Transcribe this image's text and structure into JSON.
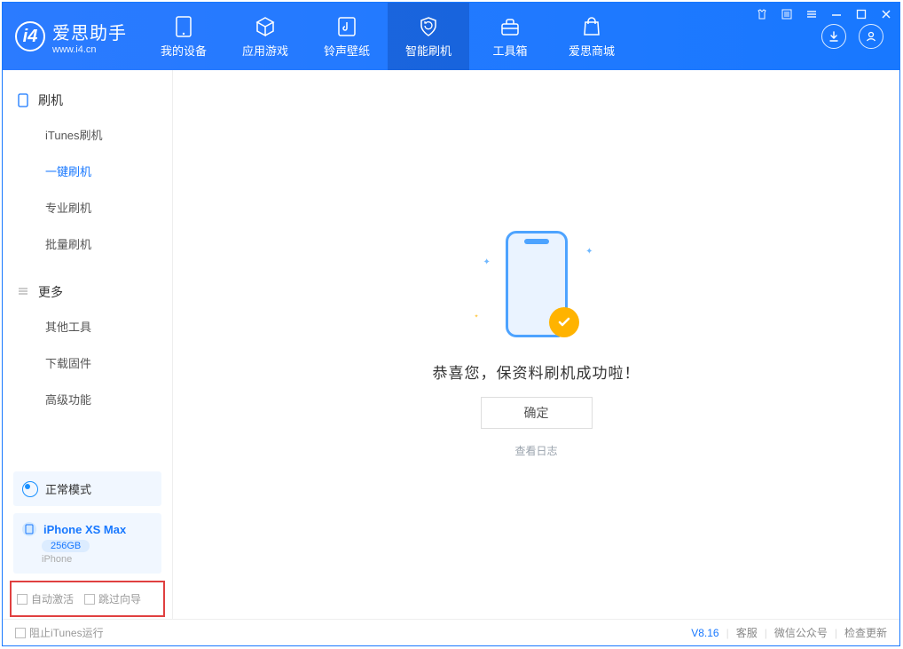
{
  "brand": {
    "cn": "爱思助手",
    "en": "www.i4.cn"
  },
  "nav": {
    "items": [
      {
        "label": "我的设备"
      },
      {
        "label": "应用游戏"
      },
      {
        "label": "铃声壁纸"
      },
      {
        "label": "智能刷机"
      },
      {
        "label": "工具箱"
      },
      {
        "label": "爱思商城"
      }
    ],
    "active_index": 3
  },
  "sidebar": {
    "section1_title": "刷机",
    "section1_items": [
      "iTunes刷机",
      "一键刷机",
      "专业刷机",
      "批量刷机"
    ],
    "section1_active": 1,
    "section2_title": "更多",
    "section2_items": [
      "其他工具",
      "下载固件",
      "高级功能"
    ]
  },
  "mode": {
    "label": "正常模式"
  },
  "device": {
    "name": "iPhone XS Max",
    "capacity": "256GB",
    "type": "iPhone"
  },
  "checks": {
    "auto_activate": "自动激活",
    "skip_wizard": "跳过向导"
  },
  "main": {
    "success_text": "恭喜您，保资料刷机成功啦！",
    "ok_button": "确定",
    "view_log": "查看日志"
  },
  "statusbar": {
    "block_itunes": "阻止iTunes运行",
    "version": "V8.16",
    "links": [
      "客服",
      "微信公众号",
      "检查更新"
    ]
  }
}
